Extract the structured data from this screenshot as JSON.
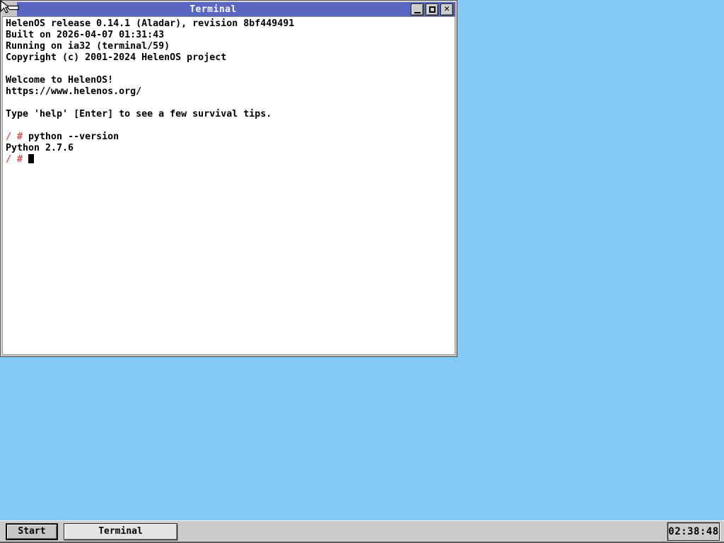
{
  "colors": {
    "desktop_bg": "#82c9f7",
    "titlebar_bg": "#5966c2",
    "prompt_color": "#e05353"
  },
  "window": {
    "title": "Terminal",
    "minimize_glyph": "_",
    "maximize_glyph": "□",
    "close_glyph": "X"
  },
  "terminal": {
    "prompt": "/ # ",
    "lines": [
      {
        "segments": [
          {
            "role": "output",
            "text": "HelenOS release 0.14.1 (Aladar), revision 8bf449491"
          }
        ]
      },
      {
        "segments": [
          {
            "role": "output",
            "text": "Built on 2026-04-07 01:31:43"
          }
        ]
      },
      {
        "segments": [
          {
            "role": "output",
            "text": "Running on ia32 (terminal/59)"
          }
        ]
      },
      {
        "segments": [
          {
            "role": "output",
            "text": "Copyright (c) 2001-2024 HelenOS project"
          }
        ]
      },
      {
        "segments": []
      },
      {
        "segments": [
          {
            "role": "output",
            "text": "Welcome to HelenOS!"
          }
        ]
      },
      {
        "segments": [
          {
            "role": "output",
            "text": "https://www.helenos.org/"
          }
        ]
      },
      {
        "segments": []
      },
      {
        "segments": [
          {
            "role": "output",
            "text": "Type 'help' [Enter] to see a few survival tips."
          }
        ]
      },
      {
        "segments": []
      },
      {
        "segments": [
          {
            "role": "prompt",
            "text": "/ # "
          },
          {
            "role": "command",
            "text": "python --version"
          }
        ]
      },
      {
        "segments": [
          {
            "role": "output",
            "text": "Python 2.7.6"
          }
        ]
      },
      {
        "segments": [
          {
            "role": "prompt",
            "text": "/ # "
          }
        ],
        "cursor": true
      }
    ]
  },
  "taskbar": {
    "start_label": "Start",
    "task_label": "Terminal",
    "clock": "02:38:48"
  }
}
